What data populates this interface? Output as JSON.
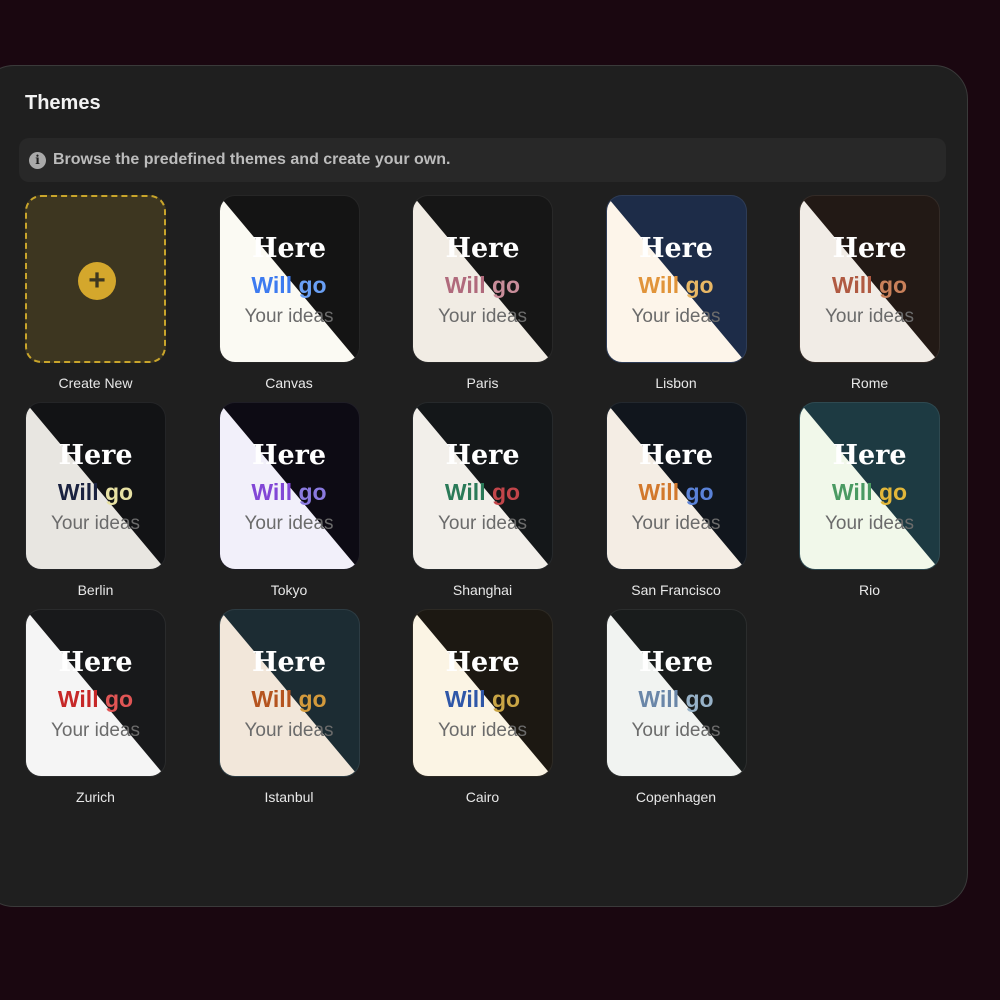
{
  "header": {
    "title": "Themes"
  },
  "info": {
    "text": "Browse the predefined themes and create your own.",
    "icon": "info-icon"
  },
  "create": {
    "label": "Create New",
    "icon": "plus-icon",
    "accent": "#d4a72c"
  },
  "preview": {
    "line1": "Here",
    "line2a": "Will",
    "line2b": "go",
    "line3": "Your ideas"
  },
  "themes": [
    {
      "name": "Canvas",
      "dark": "#141414",
      "light": "#fbfaf3",
      "c1": "#3d7bf0",
      "c2": "#6aa0f5"
    },
    {
      "name": "Paris",
      "dark": "#161616",
      "light": "#f1ece4",
      "c1": "#b06a7c",
      "c2": "#c98d9a"
    },
    {
      "name": "Lisbon",
      "dark": "#1d2c48",
      "light": "#fdf5ea",
      "c1": "#e1943a",
      "c2": "#e8b765"
    },
    {
      "name": "Rome",
      "dark": "#221915",
      "light": "#f1ece6",
      "c1": "#b05a42",
      "c2": "#c9805a"
    },
    {
      "name": "Berlin",
      "dark": "#121315",
      "light": "#e8e6e1",
      "c1": "#1a2240",
      "c2": "#e8e2a4"
    },
    {
      "name": "Tokyo",
      "dark": "#0d0b14",
      "light": "#f2f0fa",
      "c1": "#8247d6",
      "c2": "#8a7ae0"
    },
    {
      "name": "Shanghai",
      "dark": "#141719",
      "light": "#f2efea",
      "c1": "#2a7a58",
      "c2": "#c2454a"
    },
    {
      "name": "San Francisco",
      "dark": "#11161d",
      "light": "#f4ede4",
      "c1": "#d2782c",
      "c2": "#5a82d8"
    },
    {
      "name": "Rio",
      "dark": "#1d3a42",
      "light": "#f1f8ea",
      "c1": "#4a9a62",
      "c2": "#e2b73a"
    },
    {
      "name": "Zurich",
      "dark": "#18191b",
      "light": "#f5f5f5",
      "c1": "#c62828",
      "c2": "#e05555"
    },
    {
      "name": "Istanbul",
      "dark": "#1c2c33",
      "light": "#f2e7da",
      "c1": "#b5541f",
      "c2": "#d39a3c"
    },
    {
      "name": "Cairo",
      "dark": "#1c1812",
      "light": "#fbf4e4",
      "c1": "#2f57a8",
      "c2": "#c9a545"
    },
    {
      "name": "Copenhagen",
      "dark": "#191c1c",
      "light": "#f1f3f1",
      "c1": "#6a86a8",
      "c2": "#97b2c8"
    }
  ]
}
